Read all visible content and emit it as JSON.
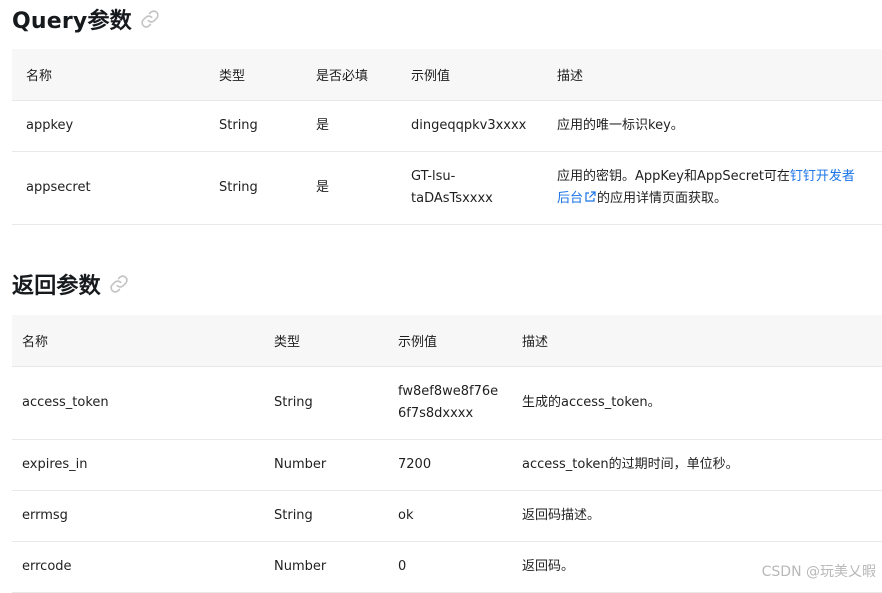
{
  "query_section": {
    "title": "Query参数",
    "icon": "link-icon",
    "columns": [
      "名称",
      "类型",
      "是否必填",
      "示例值",
      "描述"
    ],
    "rows": [
      {
        "name": "appkey",
        "type": "String",
        "required": "是",
        "example": "dingeqqpkv3xxxx",
        "desc": "应用的唯一标识key。"
      },
      {
        "name": "appsecret",
        "type": "String",
        "required": "是",
        "example_line1": "GT-lsu-",
        "example_line2": "taDAsTsxxxx",
        "desc_part1": "应用的密钥。AppKey和AppSecret可在",
        "desc_link_line1": "钉钉开发者",
        "desc_link_line2": "后台",
        "desc_part2": "的应用详情页面获取。"
      }
    ]
  },
  "return_section": {
    "title": "返回参数",
    "icon": "link-icon",
    "columns": [
      "名称",
      "类型",
      "示例值",
      "描述"
    ],
    "rows": [
      {
        "name": "access_token",
        "type": "String",
        "example_line1": "fw8ef8we8f76e",
        "example_line2": "6f7s8dxxxx",
        "desc": "生成的access_token。"
      },
      {
        "name": "expires_in",
        "type": "Number",
        "example": "7200",
        "desc": "access_token的过期时间，单位秒。"
      },
      {
        "name": "errmsg",
        "type": "String",
        "example": "ok",
        "desc": "返回码描述。"
      },
      {
        "name": "errcode",
        "type": "Number",
        "example": "0",
        "desc": "返回码。"
      }
    ]
  },
  "watermark": "CSDN @玩美乂暇",
  "colors": {
    "link": "#1a73e8",
    "header_bg": "#f7f7f8",
    "border": "#e8e8e8"
  }
}
